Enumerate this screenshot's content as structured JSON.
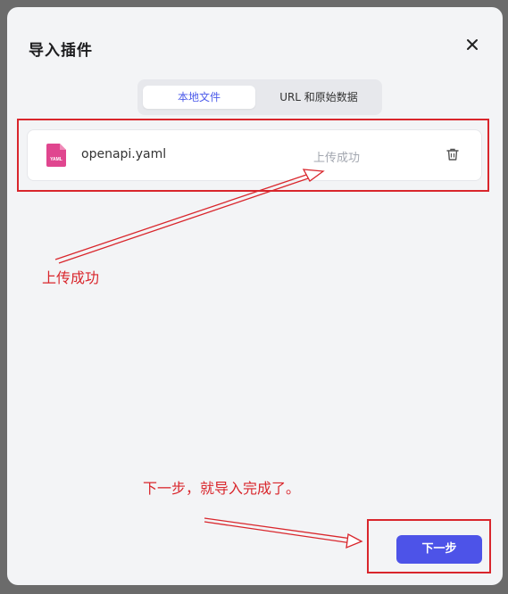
{
  "dialog": {
    "title": "导入插件",
    "close_icon": "close-icon"
  },
  "tabs": [
    {
      "label": "本地文件",
      "active": true
    },
    {
      "label": "URL 和原始数据",
      "active": false
    }
  ],
  "file": {
    "icon_text": "YAML",
    "name": "openapi.yaml",
    "status": "上传成功",
    "delete_icon": "trash-icon"
  },
  "annotations": {
    "upload_note": "上传成功",
    "next_note": "下一步，就导入完成了。"
  },
  "footer": {
    "next_label": "下一步"
  },
  "colors": {
    "accent": "#4d53e8",
    "annotation": "#d9262c",
    "file_icon": "#e0468f"
  }
}
